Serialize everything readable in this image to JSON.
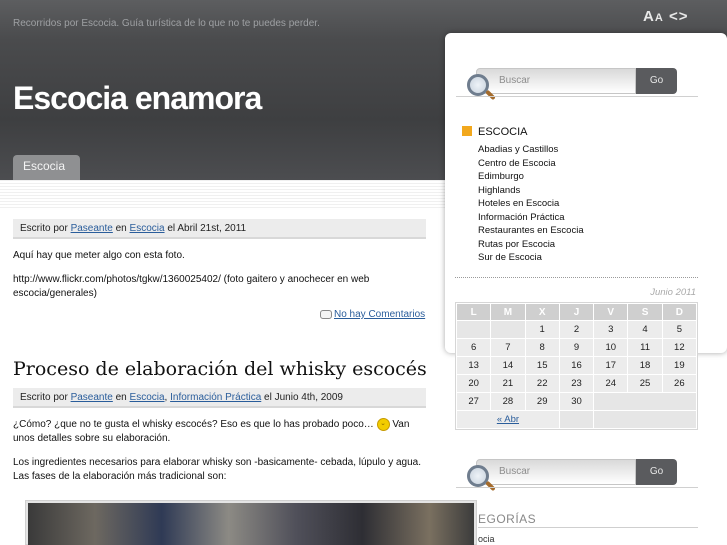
{
  "header": {
    "tagline": "Recorridos por Escocia. Guía turística de lo que no te puedes perder.",
    "font_tools": {
      "large": "A",
      "small": "A",
      "arrows": "<>"
    },
    "site_title": "Escocia enamora",
    "nav_tab": "Escocia"
  },
  "post1": {
    "meta_prefix": "Escrito por ",
    "author": "Paseante",
    "in": " en ",
    "category": "Escocia",
    "date": " el Abril 21st, 2011",
    "body1": "Aquí hay que meter algo con esta foto.",
    "body2": "http://www.flickr.com/photos/tgkw/1360025402/ (foto gaitero y anochecer en web escocia/generales)",
    "comments": "No hay Comentarios"
  },
  "post2": {
    "title": "Proceso de elaboración del whisky escocés",
    "meta_prefix": "Escrito por ",
    "author": "Paseante",
    "in": " en ",
    "category1": "Escocia",
    "comma": ", ",
    "category2": "Información Práctica",
    "date": " el Junio 4th, 2009",
    "body1a": "¿Cómo? ¿que no te gusta el whisky escocés? Eso es que lo has probado poco…",
    "body1b": " Van unos detalles sobre su elaboración.",
    "body2": "Los ingredientes necesarios para elaborar whisky son -basicamente- cebada, lúpulo y agua. Las fases de la elaboración más tradicional son:"
  },
  "sidebar": {
    "search_placeholder": "Buscar",
    "search_button": "Go",
    "category_heading": "ESCOCIA",
    "categories": [
      "Abadias y Castillos",
      "Centro de Escocia",
      "Edimburgo",
      "Highlands",
      "Hoteles en Escocia",
      "Información Práctica",
      "Restaurantes en Escocia",
      "Rutas por Escocia",
      "Sur de Escocia"
    ],
    "calendar": {
      "caption": "Junio 2011",
      "days": [
        "L",
        "M",
        "X",
        "J",
        "V",
        "S",
        "D"
      ],
      "weeks": [
        [
          "",
          "",
          "1",
          "2",
          "3",
          "4",
          "5"
        ],
        [
          "6",
          "7",
          "8",
          "9",
          "10",
          "11",
          "12"
        ],
        [
          "13",
          "14",
          "15",
          "16",
          "17",
          "18",
          "19"
        ],
        [
          "20",
          "21",
          "22",
          "23",
          "24",
          "25",
          "26"
        ],
        [
          "27",
          "28",
          "29",
          "30",
          "",
          "",
          ""
        ]
      ],
      "prev": "« Abr"
    },
    "search2_placeholder": "Buscar",
    "search2_button": "Go",
    "categories_title": "EGORÍAS",
    "categories_item": "ocia"
  },
  "colors": {
    "header_bg": "#4a4b4d",
    "link": "#2a5d9b",
    "accent": "#f2a81d"
  }
}
